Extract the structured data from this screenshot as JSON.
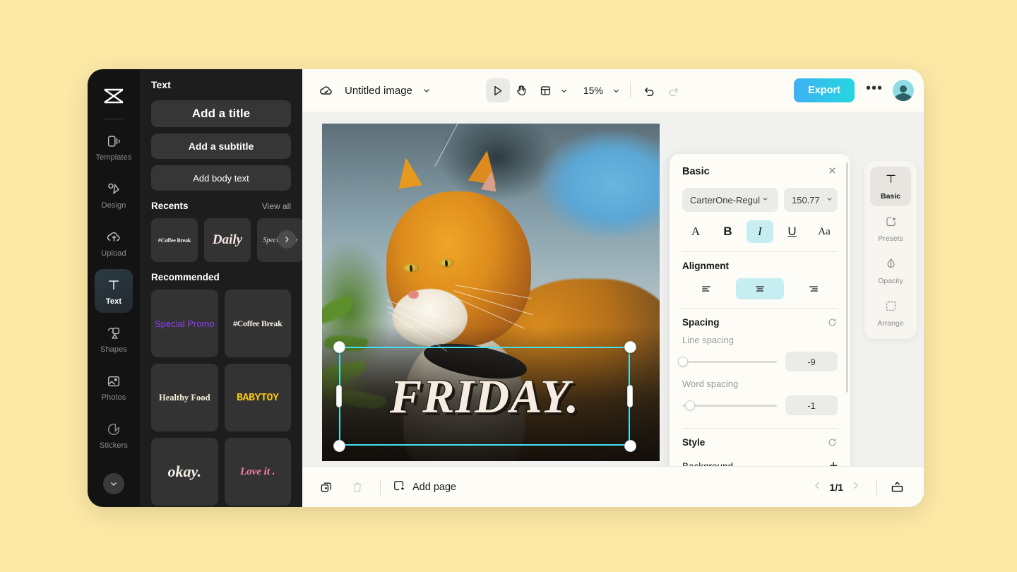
{
  "app": {
    "logo_icon": "capcut-logo-icon"
  },
  "icon_rail": {
    "items": [
      {
        "label": "Templates",
        "icon": "templates-icon",
        "active": false
      },
      {
        "label": "Design",
        "icon": "design-icon",
        "active": false
      },
      {
        "label": "Upload",
        "icon": "upload-cloud-icon",
        "active": false
      },
      {
        "label": "Text",
        "icon": "text-t-icon",
        "active": true
      },
      {
        "label": "Shapes",
        "icon": "shapes-icon",
        "active": false
      },
      {
        "label": "Photos",
        "icon": "photos-icon",
        "active": false
      },
      {
        "label": "Stickers",
        "icon": "sticker-icon",
        "active": false
      }
    ],
    "more_icon": "chevron-down-icon"
  },
  "text_panel": {
    "title": "Text",
    "buttons": [
      {
        "label": "Add a title"
      },
      {
        "label": "Add a subtitle"
      },
      {
        "label": "Add body text"
      }
    ],
    "recents": {
      "title": "Recents",
      "view_all": "View all",
      "items": [
        {
          "label": "#Coffee Break"
        },
        {
          "label": "Daily"
        },
        {
          "label": "Special Offe"
        }
      ],
      "next_icon": "chevron-right-icon"
    },
    "recommended": {
      "title": "Recommended",
      "items": [
        {
          "label": "Special Promo",
          "color": "#8a3ff0"
        },
        {
          "label": "#Coffee Break",
          "color": "#f6efe6"
        },
        {
          "label": "Healthy Food",
          "color": "#f4efd9"
        },
        {
          "label": "BABYTOY",
          "color": "#f2c41b"
        },
        {
          "label": "okay.",
          "color": "#f4efe4"
        },
        {
          "label": "Love it .",
          "color": "#ff7fb4"
        }
      ]
    }
  },
  "topbar": {
    "cloud_icon": "cloud-saved-icon",
    "doc_name": "Untitled image",
    "doc_chevron": "chevron-down-icon",
    "select_tool_icon": "cursor-arrow-icon",
    "hand_tool_icon": "hand-icon",
    "layout_tool_icon": "layout-icon",
    "layout_chevron": "chevron-down-icon",
    "zoom_level": "15%",
    "zoom_chevron": "chevron-down-icon",
    "undo_icon": "undo-icon",
    "redo_icon": "redo-icon",
    "export_label": "Export",
    "more_icon": "more-horizontal-icon",
    "avatar_icon": "user-avatar"
  },
  "canvas": {
    "text_object": {
      "content": "FRIDAY.",
      "text_color": "#f6ece1",
      "shadow_color": "#1c1713",
      "selection_color": "#41e4f2"
    }
  },
  "properties": {
    "title": "Basic",
    "close_icon": "close-icon",
    "font_family": "CarterOne-Regul",
    "font_size": "150.77",
    "style_buttons": [
      {
        "name": "font-color",
        "glyph": "A",
        "active": false
      },
      {
        "name": "bold",
        "glyph": "B",
        "active": false
      },
      {
        "name": "italic",
        "glyph": "I",
        "active": true
      },
      {
        "name": "underline",
        "glyph": "U",
        "active": false
      },
      {
        "name": "text-case",
        "glyph": "Aa",
        "active": false
      }
    ],
    "alignment": {
      "label": "Alignment",
      "options": [
        {
          "name": "align-left",
          "active": false
        },
        {
          "name": "align-center",
          "active": true
        },
        {
          "name": "align-right",
          "active": false
        }
      ]
    },
    "spacing": {
      "label": "Spacing",
      "reset_icon": "reset-icon",
      "line_spacing": {
        "label": "Line spacing",
        "value": "-9",
        "knob_pct": 1
      },
      "word_spacing": {
        "label": "Word spacing",
        "value": "-1",
        "knob_pct": 8
      }
    },
    "style": {
      "label": "Style",
      "reset_icon": "reset-icon",
      "background": {
        "label": "Background",
        "add_icon": "plus-icon"
      }
    }
  },
  "tool_rail": {
    "items": [
      {
        "label": "Basic",
        "icon": "text-t-icon",
        "active": true
      },
      {
        "label": "Presets",
        "icon": "presets-icon",
        "active": false
      },
      {
        "label": "Opacity",
        "icon": "opacity-drop-icon",
        "active": false
      },
      {
        "label": "Arrange",
        "icon": "arrange-icon",
        "active": false
      }
    ]
  },
  "bottombar": {
    "duplicate_icon": "duplicate-page-icon",
    "delete_icon": "trash-icon",
    "add_page_label": "Add page",
    "add_page_icon": "add-page-icon",
    "prev_icon": "chevron-left-icon",
    "page_indicator": "1/1",
    "next_icon": "chevron-right-icon",
    "present_icon": "present-icon"
  }
}
